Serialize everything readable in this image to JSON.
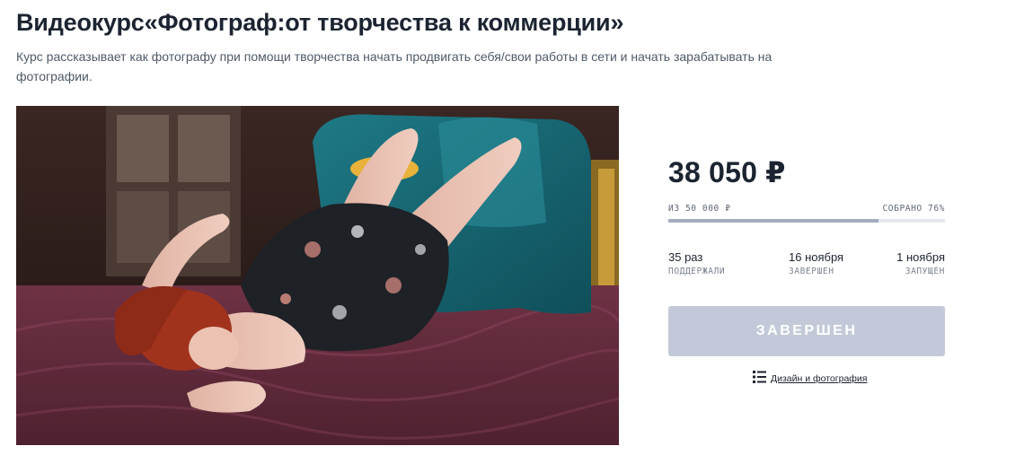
{
  "course": {
    "title": "Видеокурс«Фотограф:от творчества к коммерции»",
    "description": "Курс рассказывает как фотографу при помощи творчества начать продвигать себя/свои работы в сети и начать зарабатывать на фотографии."
  },
  "funding": {
    "raised": "38 050 ₽",
    "goal_label": "ИЗ 50 000 ₽",
    "collected_label": "СОБРАНО 76%",
    "progress_fraction": 0.76
  },
  "stats": [
    {
      "value": "35 раз",
      "label": "ПОДДЕРЖАЛИ"
    },
    {
      "value": "16 ноября",
      "label": "ЗАВЕРШЕН"
    },
    {
      "value": "1 ноября",
      "label": "ЗАПУЩЕН"
    }
  ],
  "action": {
    "button_label": "ЗАВЕРШЕН"
  },
  "category": {
    "label": "Дизайн и фотография",
    "icon": "list-icon"
  },
  "colors": {
    "title": "#1c2331",
    "progress_fill": "#a4acbe",
    "progress_track": "#e4e7ee",
    "button_bg": "#c3c9d8"
  }
}
